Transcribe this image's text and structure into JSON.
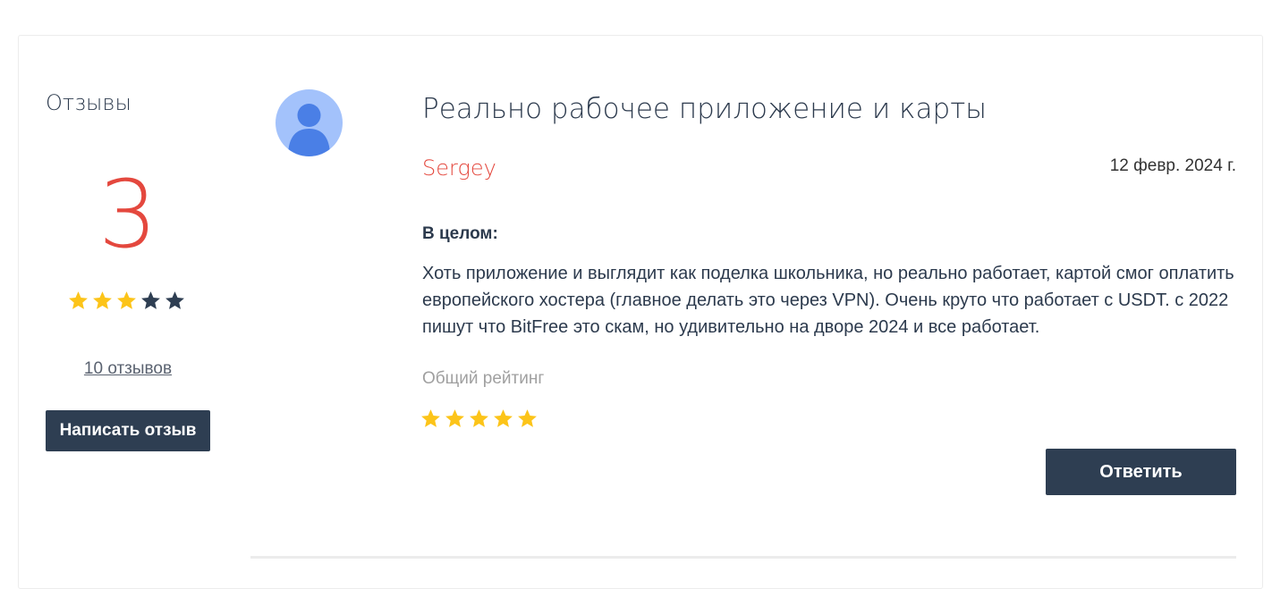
{
  "summary": {
    "title": "Отзывы",
    "rating": "3",
    "rating_value": 3,
    "rating_max": 5,
    "review_count_link": "10 отзывов",
    "write_button": "Написать отзыв"
  },
  "review": {
    "title": "Реально рабочее приложение и карты",
    "author": "Sergey",
    "date": "12 февр. 2024 г.",
    "section_label": "В целом:",
    "body": "Хоть приложение и выглядит как поделка школьника, но реально работает, картой смог оплатить европейского хостера (главное делать это через VPN). Очень круто что работает с USDT. с 2022 пишут что BitFree это скам, но удивительно на дворе 2024 и все работает.",
    "rating_label": "Общий рейтинг",
    "rating_value": 5,
    "rating_max": 5,
    "reply_button": "Ответить"
  },
  "icons": {
    "star": "star-icon",
    "avatar": "user-avatar-icon"
  },
  "colors": {
    "accent_red": "#e4483e",
    "button_dark": "#2e3e52",
    "star_filled": "#fcc419",
    "star_empty": "#2e3e52",
    "avatar_bg": "#a3c2fb",
    "avatar_fg": "#4a7fe6"
  }
}
